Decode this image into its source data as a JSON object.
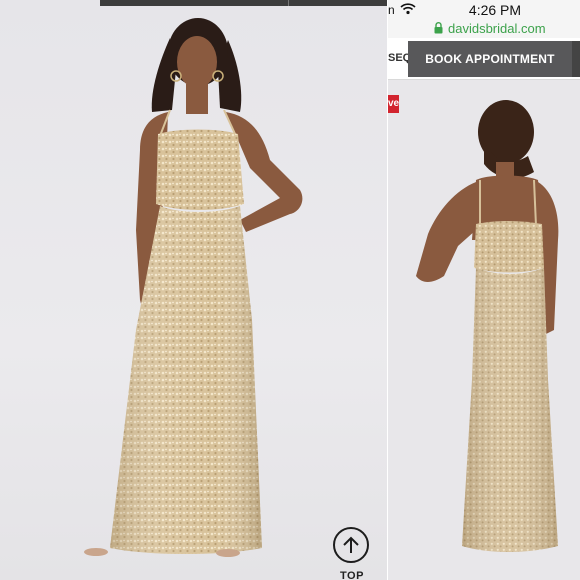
{
  "status_bar": {
    "carrier_fragment": "n",
    "time": "4:26 PM"
  },
  "browser": {
    "url": "davidsbridal.com"
  },
  "nav": {
    "cut_off_label": "SEQ",
    "book_appointment_label": "BOOK APPOINTMENT"
  },
  "badge": {
    "label": "ve"
  },
  "scroll_top": {
    "label": "TOP"
  },
  "colors": {
    "background": "#e9e8eb",
    "dress_gold": "#d9c39a",
    "book_button": "#58585a",
    "url_green": "#3ca24b",
    "badge_red": "#d2242f"
  },
  "icons": [
    "wifi-icon",
    "lock-icon",
    "arrow-up-icon"
  ]
}
